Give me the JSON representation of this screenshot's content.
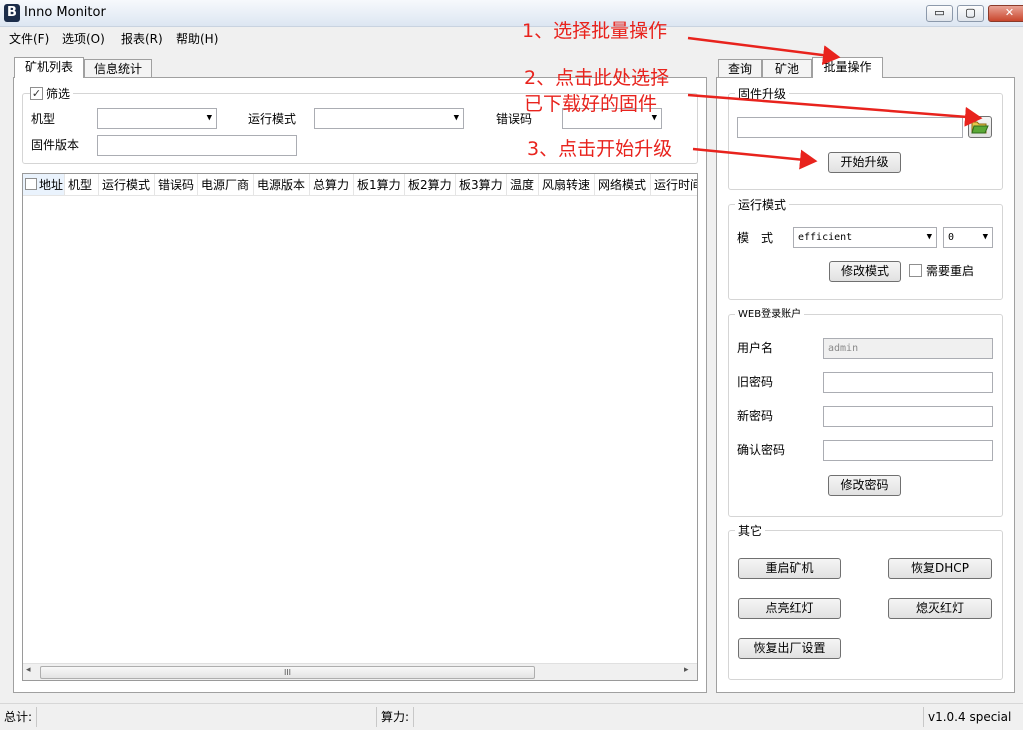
{
  "window": {
    "title": "Inno Monitor",
    "icon_letter": "B",
    "minimize": "▭",
    "maximize": "▢",
    "close": "✕"
  },
  "menu": [
    "文件(F)",
    "选项(O)",
    "报表(R)",
    "帮助(H)"
  ],
  "left": {
    "tabs": [
      "矿机列表",
      "信息统计"
    ],
    "filter": {
      "checkbox_label": "筛选",
      "checked": true,
      "model_label": "机型",
      "mode_label": "运行模式",
      "error_label": "错误码",
      "firmware_label": "固件版本"
    },
    "columns": [
      "地址",
      "机型",
      "运行模式",
      "错误码",
      "电源厂商",
      "电源版本",
      "总算力",
      "板1算力",
      "板2算力",
      "板3算力",
      "温度",
      "风扇转速",
      "网络模式",
      "运行时间"
    ],
    "scroll_grip": "III"
  },
  "right": {
    "tabs": [
      "查询",
      "矿池",
      "批量操作"
    ],
    "firmware": {
      "title": "固件升级",
      "path_value": "",
      "start_button": "开始升级"
    },
    "run_mode": {
      "title": "运行模式",
      "mode_label": "模　式",
      "mode_value": "efficient",
      "level_value": "0",
      "modify_button": "修改模式",
      "reboot_label": "需要重启",
      "reboot_checked": false
    },
    "web_account": {
      "title": "WEB登录账户",
      "username_label": "用户名",
      "username_value": "admin",
      "old_pw_label": "旧密码",
      "new_pw_label": "新密码",
      "confirm_pw_label": "确认密码",
      "modify_pw_button": "修改密码"
    },
    "other": {
      "title": "其它",
      "reboot_miner": "重启矿机",
      "restore_dhcp": "恢复DHCP",
      "light_red": "点亮红灯",
      "off_red": "熄灭红灯",
      "factory_reset": "恢复出厂设置"
    }
  },
  "status": {
    "total_label": "总计:",
    "hashrate_label": "算力:",
    "version": "v1.0.4 special"
  },
  "annotations": {
    "step1": "1、选择批量操作",
    "step2_line1": "2、点击此处选择",
    "step2_line2": "已下载好的固件",
    "step3": "3、点击开始升级",
    "color": "#e8231d"
  }
}
